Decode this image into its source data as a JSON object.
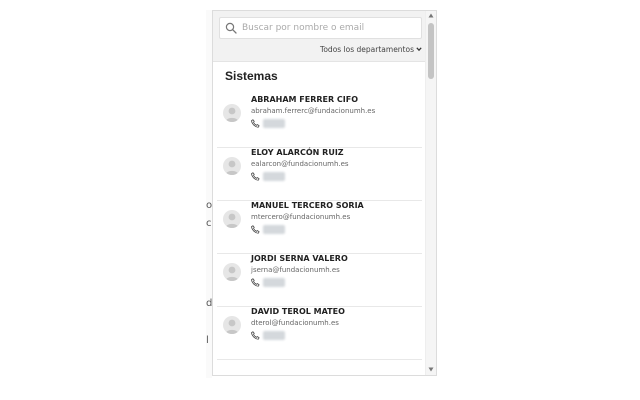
{
  "search": {
    "placeholder": "Buscar por nombre o email"
  },
  "filter": {
    "department_label": "Todos los departamentos"
  },
  "section": {
    "title": "Sistemas"
  },
  "contacts": [
    {
      "name": "ABRAHAM FERRER CIFO",
      "email": "abraham.ferrerc@fundacionumh.es"
    },
    {
      "name": "ELOY ALARCÓN RUIZ",
      "email": "ealarcon@fundacionumh.es"
    },
    {
      "name": "MANUEL TERCERO SORIA",
      "email": "mtercero@fundacionumh.es"
    },
    {
      "name": "JORDI SERNA VALERO",
      "email": "jserna@fundacionumh.es"
    },
    {
      "name": "DAVID TEROL MATEO",
      "email": "dterol@fundacionumh.es"
    }
  ],
  "background": {
    "letters": [
      "o",
      "c",
      "d",
      "l"
    ]
  }
}
